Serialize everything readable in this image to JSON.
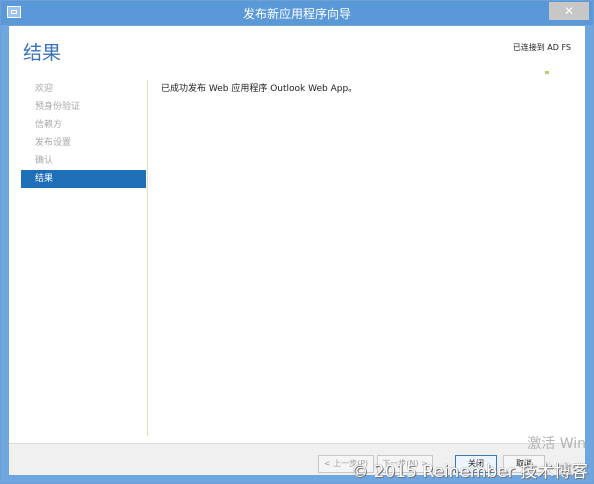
{
  "window": {
    "title": "发布新应用程序向导",
    "close_label": "✕"
  },
  "header": {
    "page_title": "结果",
    "connection_status": "已连接到 AD FS"
  },
  "nav": {
    "items": [
      {
        "label": "欢迎"
      },
      {
        "label": "预身份验证"
      },
      {
        "label": "信赖方"
      },
      {
        "label": "发布设置"
      },
      {
        "label": "确认"
      },
      {
        "label": "结果"
      }
    ]
  },
  "main": {
    "message": "已成功发布 Web 应用程序 Outlook Web App。"
  },
  "buttons": {
    "prev": "< 上一步(P)",
    "next": "下一步(N) >",
    "close": "关闭",
    "cancel": "取消"
  },
  "watermark": {
    "activation": "激活 Win"
  },
  "credit": "© 2015 Reinember 技术博客"
}
